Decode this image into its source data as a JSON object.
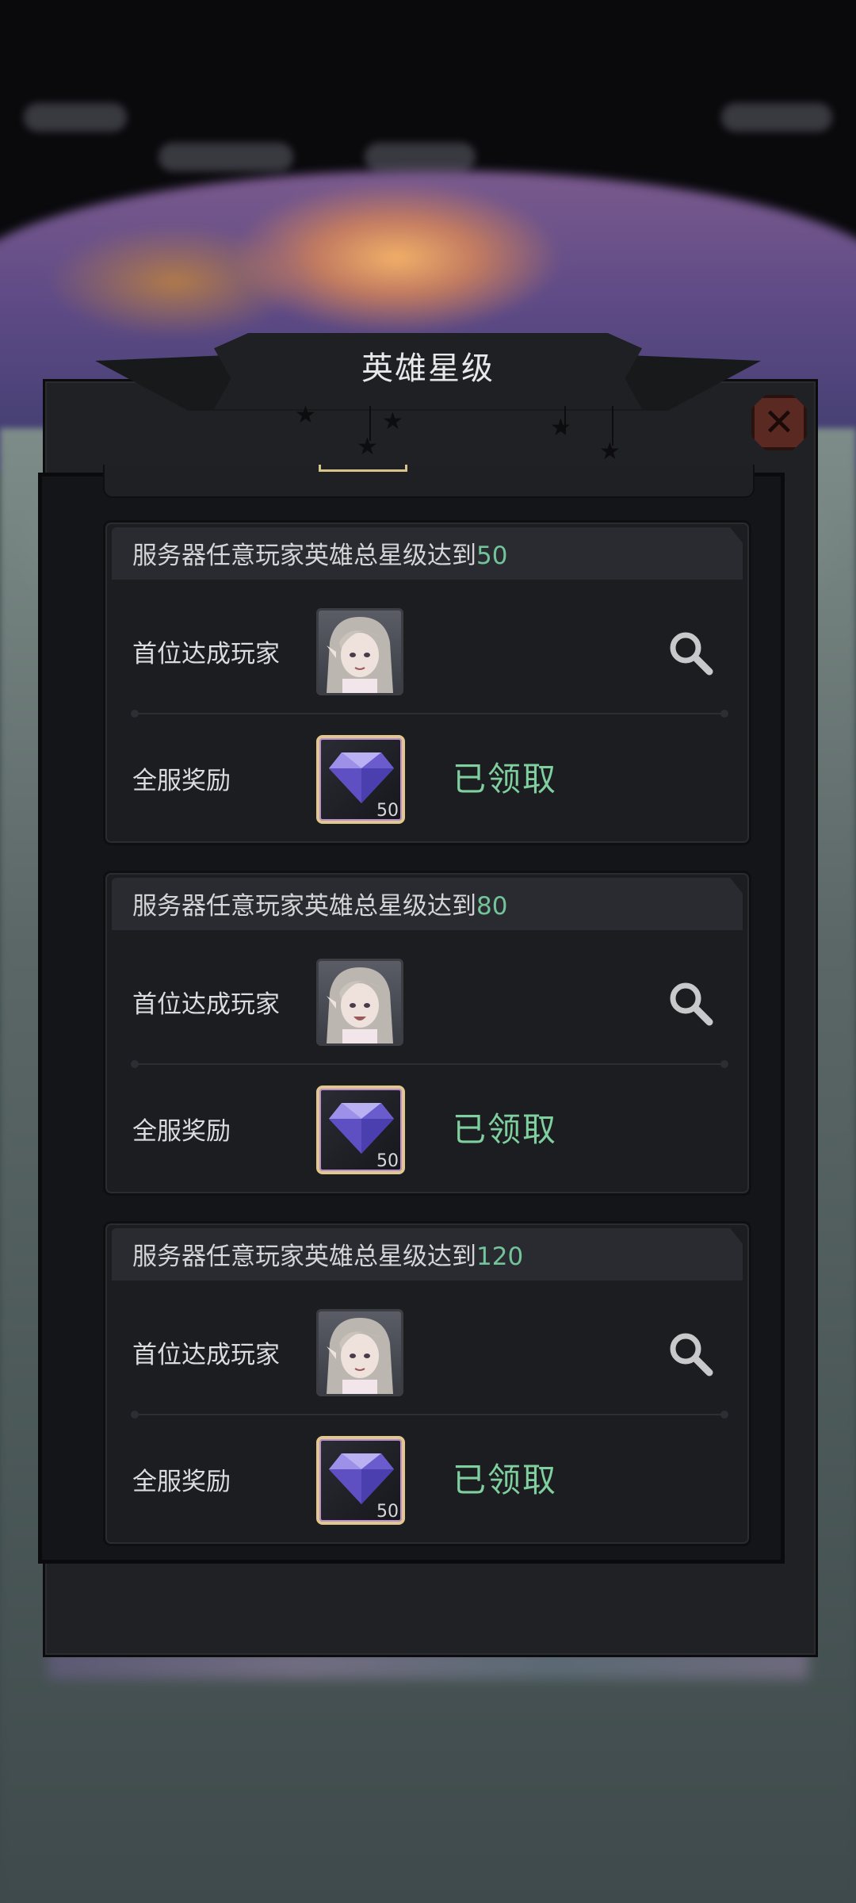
{
  "dialog": {
    "title": "英雄星级",
    "close_icon": "close-icon"
  },
  "cards": [
    {
      "title_prefix": "服务器任意玩家英雄总星级达到",
      "target": "50",
      "first_player_label": "首位达成玩家",
      "reward_label": "全服奖励",
      "reward_count": "50",
      "reward_icon": "diamond-icon",
      "status": "已领取"
    },
    {
      "title_prefix": "服务器任意玩家英雄总星级达到",
      "target": "80",
      "first_player_label": "首位达成玩家",
      "reward_label": "全服奖励",
      "reward_count": "50",
      "reward_icon": "diamond-icon",
      "status": "已领取"
    },
    {
      "title_prefix": "服务器任意玩家英雄总星级达到",
      "target": "120",
      "first_player_label": "首位达成玩家",
      "reward_label": "全服奖励",
      "reward_count": "50",
      "reward_icon": "diamond-icon",
      "status": "已领取"
    }
  ],
  "colors": {
    "accent_green": "#73c49a",
    "claimed_green": "#7fcf9f",
    "panel_bg": "#202124",
    "close_red": "#5a2a22"
  }
}
